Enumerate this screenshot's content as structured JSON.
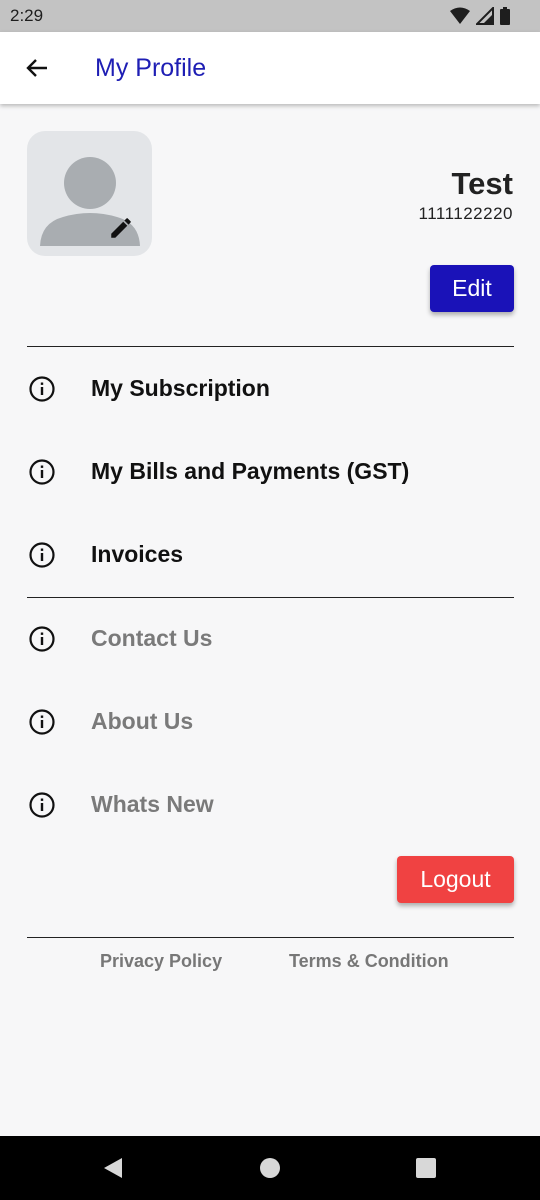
{
  "status_bar": {
    "time": "2:29"
  },
  "app_bar": {
    "title": "My Profile"
  },
  "profile": {
    "name": "Test",
    "phone": "1111122220",
    "edit_label": "Edit"
  },
  "menu": {
    "primary": [
      {
        "label": "My Subscription",
        "icon": "info-icon"
      },
      {
        "label": "My Bills and Payments (GST)",
        "icon": "info-icon"
      },
      {
        "label": "Invoices",
        "icon": "info-icon"
      }
    ],
    "secondary": [
      {
        "label": "Contact Us",
        "icon": "info-icon"
      },
      {
        "label": "About Us",
        "icon": "info-icon"
      },
      {
        "label": "Whats New",
        "icon": "info-icon"
      }
    ]
  },
  "logout_label": "Logout",
  "footer": {
    "privacy": "Privacy Policy",
    "terms": "Terms & Condition"
  },
  "colors": {
    "accent": "#1a12b8",
    "title": "#1e1eb4",
    "logout": "#f04242",
    "muted": "#7a7a7a"
  }
}
